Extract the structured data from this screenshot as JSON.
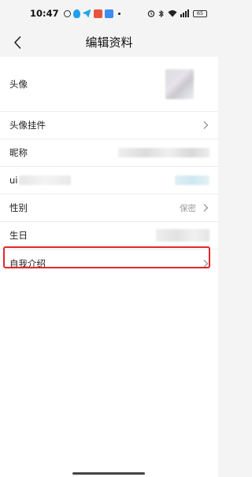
{
  "status": {
    "time": "10:47",
    "battery": "65"
  },
  "header": {
    "title": "编辑资料"
  },
  "rows": {
    "avatar": {
      "label": "头像"
    },
    "avatar_frame": {
      "label": "头像挂件"
    },
    "nickname": {
      "label": "昵称"
    },
    "uid": {
      "label": "ui"
    },
    "gender": {
      "label": "性别",
      "value": "保密"
    },
    "birthday": {
      "label": "生日"
    },
    "bio": {
      "label": "自我介绍"
    }
  },
  "colors": {
    "highlight": "#e3262a"
  }
}
